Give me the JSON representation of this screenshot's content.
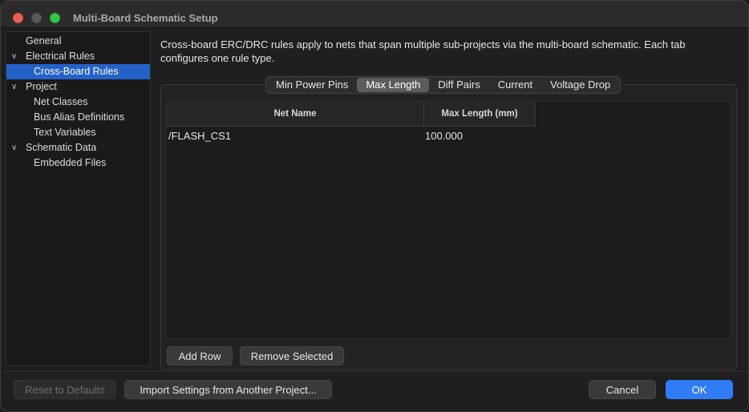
{
  "window": {
    "title": "Multi-Board Schematic Setup"
  },
  "sidebar": {
    "items": [
      {
        "label": "General",
        "indent": 0,
        "expandable": false,
        "selected": false
      },
      {
        "label": "Electrical Rules",
        "indent": 0,
        "expandable": true,
        "selected": false
      },
      {
        "label": "Cross-Board Rules",
        "indent": 1,
        "expandable": false,
        "selected": true
      },
      {
        "label": "Project",
        "indent": 0,
        "expandable": true,
        "selected": false
      },
      {
        "label": "Net Classes",
        "indent": 1,
        "expandable": false,
        "selected": false
      },
      {
        "label": "Bus Alias Definitions",
        "indent": 1,
        "expandable": false,
        "selected": false
      },
      {
        "label": "Text Variables",
        "indent": 1,
        "expandable": false,
        "selected": false
      },
      {
        "label": "Schematic Data",
        "indent": 0,
        "expandable": true,
        "selected": false
      },
      {
        "label": "Embedded Files",
        "indent": 1,
        "expandable": false,
        "selected": false
      }
    ]
  },
  "main": {
    "description": "Cross-board ERC/DRC rules apply to nets that span multiple sub-projects via the multi-board schematic. Each tab configures one rule type.",
    "tabs": [
      {
        "label": "Min Power Pins",
        "active": false
      },
      {
        "label": "Max Length",
        "active": true
      },
      {
        "label": "Diff Pairs",
        "active": false
      },
      {
        "label": "Current",
        "active": false
      },
      {
        "label": "Voltage Drop",
        "active": false
      }
    ],
    "grid": {
      "columns": [
        "Net Name",
        "Max Length (mm)"
      ],
      "rows": [
        [
          "/FLASH_CS1",
          "100.000"
        ]
      ]
    },
    "add_row_label": "Add Row",
    "remove_selected_label": "Remove Selected"
  },
  "footer": {
    "reset_label": "Reset to Defaults",
    "import_label": "Import Settings from Another Project...",
    "cancel_label": "Cancel",
    "ok_label": "OK"
  },
  "colors": {
    "accent": "#2f7cf6",
    "selection": "#2462c9",
    "close": "#ec5f57",
    "zoom": "#35c748"
  },
  "icons": {
    "expand": "chevron-down-icon"
  }
}
